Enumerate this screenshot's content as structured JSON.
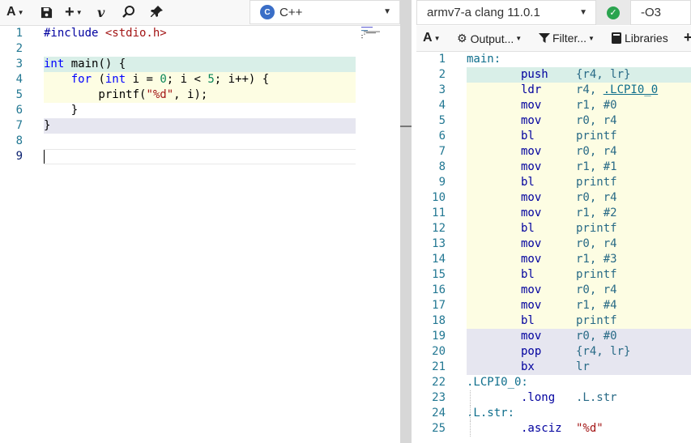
{
  "editor": {
    "toolbar": {
      "font_button": "A",
      "save_icon": "save-icon",
      "add_button": "+",
      "vim_button": "v",
      "search_icon": "search-icon",
      "pin_icon": "pin-icon"
    },
    "language": "C++",
    "language_logo": "C",
    "lines": [
      {
        "n": "1",
        "code": "#include <stdio.h>"
      },
      {
        "n": "2",
        "code": ""
      },
      {
        "n": "3",
        "code": "int main() {"
      },
      {
        "n": "4",
        "code": "    for (int i = 0; i < 5; i++) {"
      },
      {
        "n": "5",
        "code": "        printf(\"%d\", i);"
      },
      {
        "n": "6",
        "code": "    }"
      },
      {
        "n": "7",
        "code": "}"
      },
      {
        "n": "8",
        "code": ""
      },
      {
        "n": "9",
        "code": ""
      }
    ]
  },
  "compiler": {
    "name": "armv7-a clang 11.0.1",
    "status_icon": "check-icon",
    "options": "-O3",
    "toolbar": {
      "font_button": "A",
      "output_label": "Output...",
      "filter_label": "Filter...",
      "libraries_label": "Libraries",
      "add_label": "+"
    },
    "asm": [
      {
        "n": "1",
        "label": "main:",
        "op": "",
        "args": ""
      },
      {
        "n": "2",
        "label": "",
        "op": "push",
        "args": "{r4, lr}"
      },
      {
        "n": "3",
        "label": "",
        "op": "ldr",
        "args": "r4, ",
        "link": ".LCPI0_0"
      },
      {
        "n": "4",
        "label": "",
        "op": "mov",
        "args": "r1, #0"
      },
      {
        "n": "5",
        "label": "",
        "op": "mov",
        "args": "r0, r4"
      },
      {
        "n": "6",
        "label": "",
        "op": "bl",
        "args": "printf"
      },
      {
        "n": "7",
        "label": "",
        "op": "mov",
        "args": "r0, r4"
      },
      {
        "n": "8",
        "label": "",
        "op": "mov",
        "args": "r1, #1"
      },
      {
        "n": "9",
        "label": "",
        "op": "bl",
        "args": "printf"
      },
      {
        "n": "10",
        "label": "",
        "op": "mov",
        "args": "r0, r4"
      },
      {
        "n": "11",
        "label": "",
        "op": "mov",
        "args": "r1, #2"
      },
      {
        "n": "12",
        "label": "",
        "op": "bl",
        "args": "printf"
      },
      {
        "n": "13",
        "label": "",
        "op": "mov",
        "args": "r0, r4"
      },
      {
        "n": "14",
        "label": "",
        "op": "mov",
        "args": "r1, #3"
      },
      {
        "n": "15",
        "label": "",
        "op": "bl",
        "args": "printf"
      },
      {
        "n": "16",
        "label": "",
        "op": "mov",
        "args": "r0, r4"
      },
      {
        "n": "17",
        "label": "",
        "op": "mov",
        "args": "r1, #4"
      },
      {
        "n": "18",
        "label": "",
        "op": "bl",
        "args": "printf"
      },
      {
        "n": "19",
        "label": "",
        "op": "mov",
        "args": "r0, #0"
      },
      {
        "n": "20",
        "label": "",
        "op": "pop",
        "args": "{r4, lr}"
      },
      {
        "n": "21",
        "label": "",
        "op": "bx",
        "args": "lr"
      },
      {
        "n": "22",
        "label": ".LCPI0_0:",
        "op": "",
        "args": ""
      },
      {
        "n": "23",
        "label": "",
        "op": ".long",
        "args": ".L.str"
      },
      {
        "n": "24",
        "label": ".L.str:",
        "op": "",
        "args": ""
      },
      {
        "n": "25",
        "label": "",
        "op": ".asciz",
        "args": "\"%d\""
      }
    ]
  },
  "colors": {
    "highlight_teal": "#d9efe8",
    "highlight_yellow": "#fdfde3",
    "highlight_lavender": "#e6e6f0",
    "line_number": "#237893",
    "keyword": "#0000ff"
  }
}
